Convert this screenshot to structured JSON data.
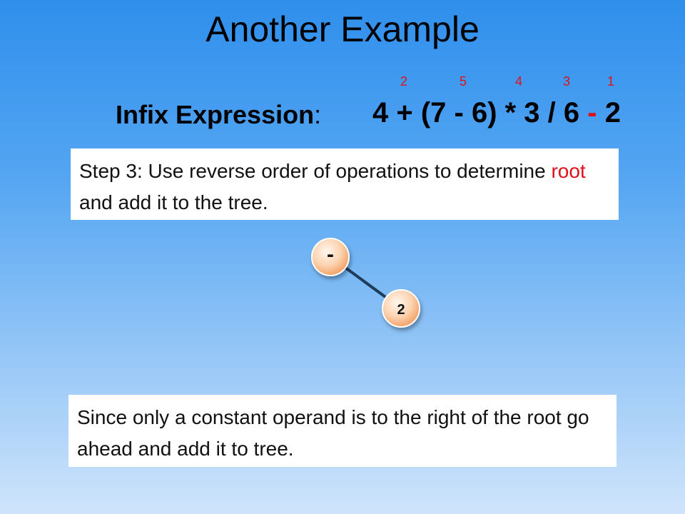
{
  "slide": {
    "title": "Another Example",
    "precedence_numbers": [
      "2",
      "5",
      "4",
      "3",
      "1"
    ],
    "infix": {
      "label": "Infix Expression",
      "colon": ":",
      "expression_before": "4 + (7 - 6) * 3 / 6 ",
      "root_operator": "-",
      "expression_after": " 2"
    },
    "step_box": {
      "text_before": "Step 3: Use reverse order of operations to determine ",
      "highlight": "root",
      "text_after": " and add it to the tree."
    },
    "tree": {
      "nodes": [
        {
          "id": "root",
          "label": "-"
        },
        {
          "id": "right",
          "label": "2"
        }
      ],
      "edges": [
        {
          "from": "root",
          "to": "right"
        }
      ]
    },
    "info_box": {
      "text": "Since only a constant operand is to the right of the root go ahead and add it to tree."
    },
    "colors": {
      "accent_red": "#e0101a",
      "node_fill_light": "#fff3e8",
      "node_fill_dark": "#f5a46a",
      "edge": "#1f3b5a"
    }
  }
}
